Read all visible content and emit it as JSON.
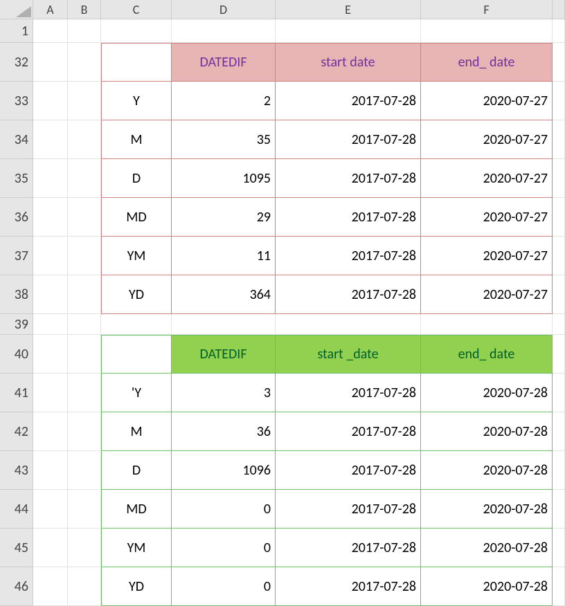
{
  "columns": [
    "A",
    "B",
    "C",
    "D",
    "E",
    "F"
  ],
  "rowLabels": [
    "1",
    "32",
    "33",
    "34",
    "35",
    "36",
    "37",
    "38",
    "39",
    "40",
    "41",
    "42",
    "43",
    "44",
    "45",
    "46"
  ],
  "table1": {
    "headers": {
      "c": "",
      "d": "DATEDIF",
      "e": "start date",
      "f": "end_ date"
    },
    "rows": [
      {
        "c": "Y",
        "d": "2",
        "e": "2017-07-28",
        "f": "2020-07-27"
      },
      {
        "c": "M",
        "d": "35",
        "e": "2017-07-28",
        "f": "2020-07-27"
      },
      {
        "c": "D",
        "d": "1095",
        "e": "2017-07-28",
        "f": "2020-07-27"
      },
      {
        "c": "MD",
        "d": "29",
        "e": "2017-07-28",
        "f": "2020-07-27"
      },
      {
        "c": "YM",
        "d": "11",
        "e": "2017-07-28",
        "f": "2020-07-27"
      },
      {
        "c": "YD",
        "d": "364",
        "e": "2017-07-28",
        "f": "2020-07-27"
      }
    ]
  },
  "table2": {
    "headers": {
      "c": "",
      "d": "DATEDIF",
      "e": "start _date",
      "f": "end_ date"
    },
    "rows": [
      {
        "c": "'Y",
        "d": "3",
        "e": "2017-07-28",
        "f": "2020-07-28"
      },
      {
        "c": "M",
        "d": "36",
        "e": "2017-07-28",
        "f": "2020-07-28"
      },
      {
        "c": "D",
        "d": "1096",
        "e": "2017-07-28",
        "f": "2020-07-28"
      },
      {
        "c": "MD",
        "d": "0",
        "e": "2017-07-28",
        "f": "2020-07-28"
      },
      {
        "c": "YM",
        "d": "0",
        "e": "2017-07-28",
        "f": "2020-07-28"
      },
      {
        "c": "YD",
        "d": "0",
        "e": "2017-07-28",
        "f": "2020-07-28"
      }
    ]
  }
}
